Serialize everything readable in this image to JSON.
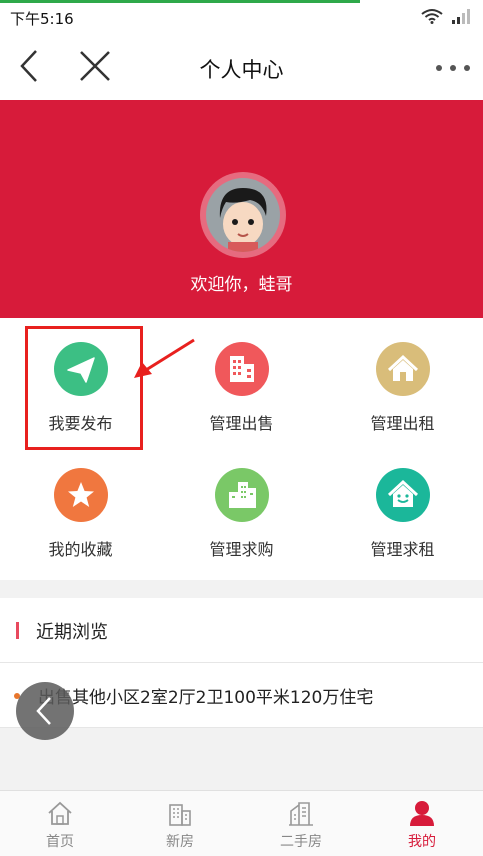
{
  "status_bar": {
    "time": "下午5:16"
  },
  "nav": {
    "title": "个人中心"
  },
  "profile": {
    "welcome": "欢迎你，蛙哥"
  },
  "grid": [
    {
      "label": "我要发布",
      "icon": "paper-plane-icon",
      "color": "#3cbf84"
    },
    {
      "label": "管理出售",
      "icon": "building-icon",
      "color": "#f0585b"
    },
    {
      "label": "管理出租",
      "icon": "house-icon",
      "color": "#d9bd7a"
    },
    {
      "label": "我的收藏",
      "icon": "star-icon",
      "color": "#f0773f"
    },
    {
      "label": "管理求购",
      "icon": "buildings-icon",
      "color": "#7ac867"
    },
    {
      "label": "管理求租",
      "icon": "smiley-house-icon",
      "color": "#1bb79a"
    }
  ],
  "recent": {
    "title": "近期浏览",
    "items": [
      {
        "text": "出售其他小区2室2厅2卫100平米120万住宅"
      }
    ]
  },
  "tabs": [
    {
      "label": "首页",
      "icon": "home-icon",
      "active": false
    },
    {
      "label": "新房",
      "icon": "new-building-icon",
      "active": false
    },
    {
      "label": "二手房",
      "icon": "second-hand-building-icon",
      "active": false
    },
    {
      "label": "我的",
      "icon": "user-icon",
      "active": true
    }
  ],
  "colors": {
    "header_bg": "#d71b3a",
    "highlight": "#e8201e",
    "active_tab": "#d71b3a"
  }
}
